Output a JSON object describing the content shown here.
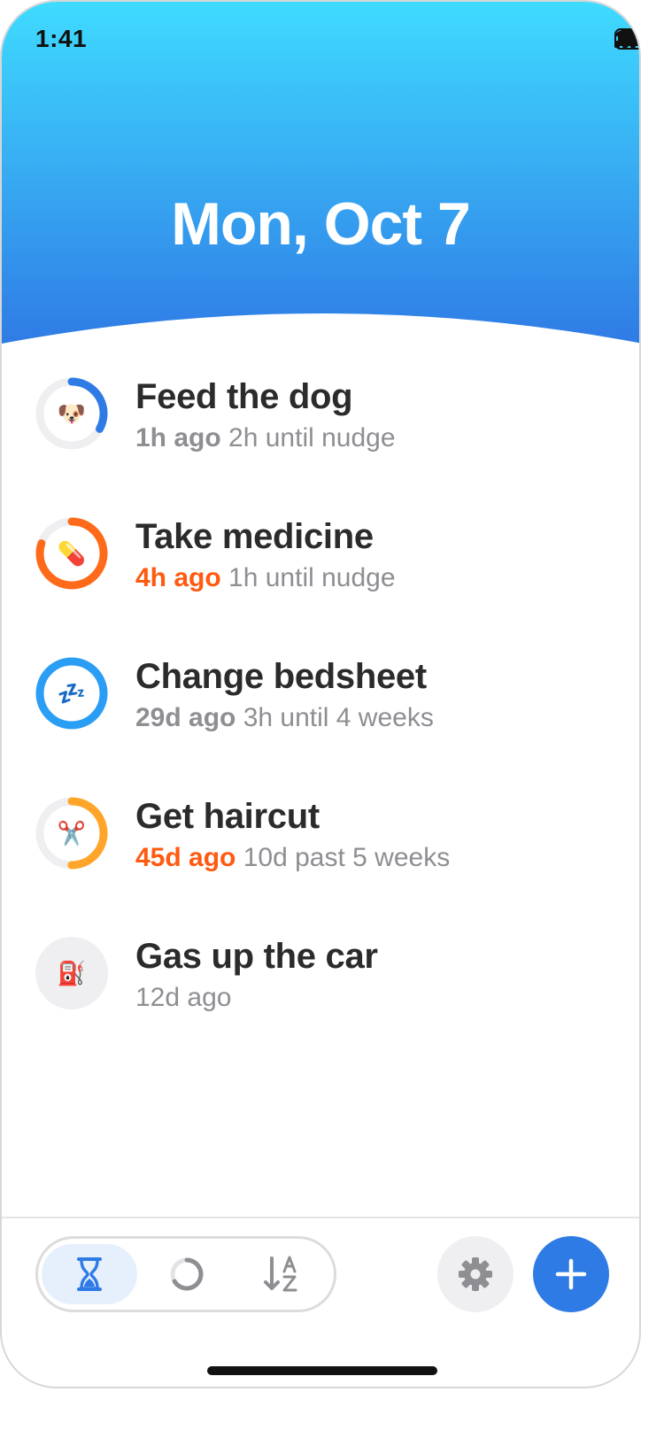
{
  "status_bar": {
    "time": "1:41"
  },
  "header": {
    "date": "Mon, Oct 7"
  },
  "items": [
    {
      "title": "Feed the dog",
      "ago": "1h ago",
      "ago_alert": false,
      "detail": "2h until nudge",
      "icon": "dog-face-icon",
      "emoji": "🐶",
      "progress": 0.33,
      "ring_color": "#2f7be5"
    },
    {
      "title": "Take medicine",
      "ago": "4h ago",
      "ago_alert": true,
      "detail": "1h until nudge",
      "icon": "pill-icon",
      "emoji": "💊",
      "progress": 0.8,
      "ring_color": "#ff6a1a"
    },
    {
      "title": "Change bedsheet",
      "ago": "29d ago",
      "ago_alert": false,
      "detail": "3h until 4 weeks",
      "icon": "zzz-icon",
      "emoji": "💤",
      "progress": 1.0,
      "ring_color": "#2a9df4"
    },
    {
      "title": "Get haircut",
      "ago": "45d ago",
      "ago_alert": true,
      "detail": "10d past 5 weeks",
      "icon": "scissors-icon",
      "emoji": "✂️",
      "progress": 0.5,
      "ring_color": "#ffa52a"
    },
    {
      "title": "Gas up the car",
      "ago": "",
      "ago_alert": false,
      "detail": "12d ago",
      "icon": "fuel-pump-icon",
      "emoji": "⛽",
      "progress": 0,
      "ring_color": "#cccccc"
    }
  ],
  "toolbar": {
    "segments": [
      {
        "name": "hourglass-icon",
        "active": true
      },
      {
        "name": "circle-progress-icon",
        "active": false
      },
      {
        "name": "sort-az-icon",
        "active": false
      }
    ],
    "settings_icon": "gear-icon",
    "add_icon": "plus-icon"
  },
  "colors": {
    "header_top": "#3fdbff",
    "header_bottom": "#2f7be5",
    "alert": "#ff5a10",
    "accent": "#2f7be5"
  }
}
